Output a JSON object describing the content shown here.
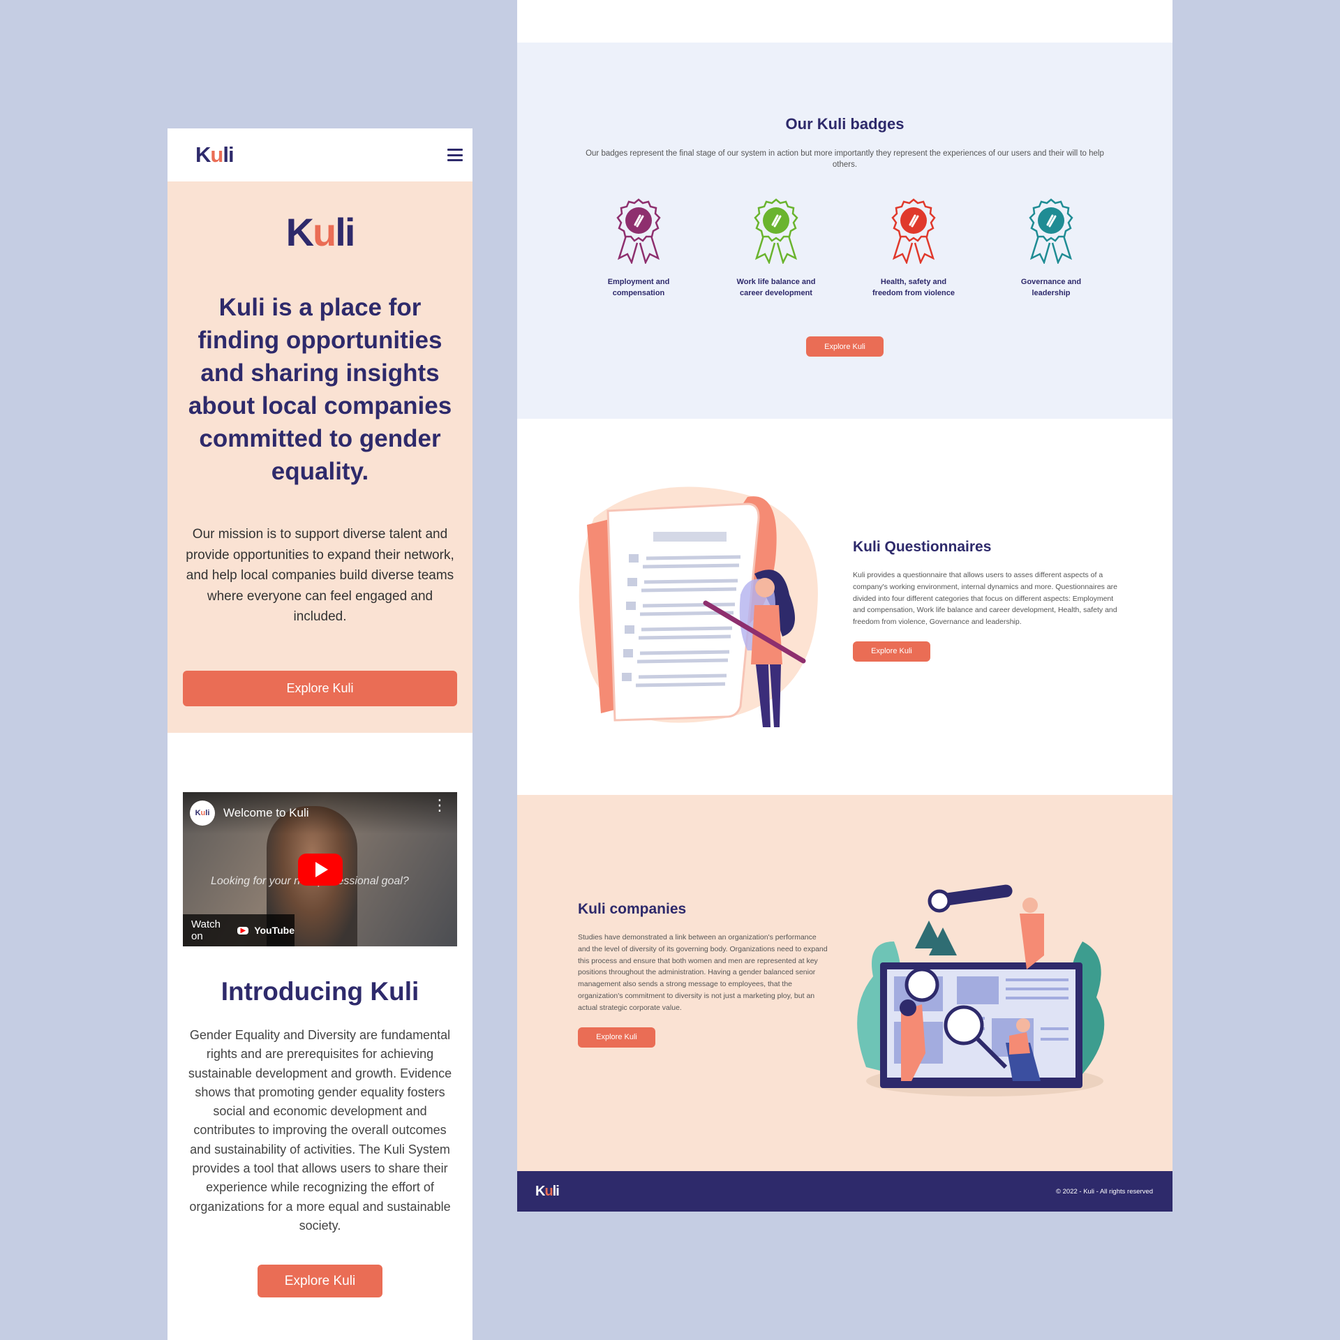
{
  "brand": {
    "logo_text": "Kuli"
  },
  "mobile": {
    "hero": {
      "headline": "Kuli is a place for finding opportunities and sharing insights about local companies committed to gender equality.",
      "mission": "Our mission is to support diverse talent and provide opportunities to expand their network, and help local companies build diverse teams where everyone can feel engaged and included.",
      "cta": "Explore Kuli"
    },
    "video": {
      "channel": "Kuli",
      "title": "Welcome to Kuli",
      "caption": "Looking for your next professional goal?",
      "watch_on": "Watch on",
      "youtube": "YouTube"
    },
    "intro": {
      "title": "Introducing Kuli",
      "body": "Gender Equality and Diversity are fundamental rights and are prerequisites for achieving sustainable development and growth. Evidence shows that promoting gender equality fosters social and economic development and contributes to improving the overall outcomes and sustainability of activities. The Kuli System provides a tool that allows users to share their experience while recognizing the effort of organizations for a more equal and sustainable society.",
      "cta": "Explore Kuli"
    }
  },
  "desktop": {
    "badges": {
      "title": "Our Kuli badges",
      "subtitle": "Our badges represent the final stage of our system in action but more importantly they represent the experiences of our users and their will to help others.",
      "items": [
        {
          "label": "Employment and compensation",
          "color": "#8e2f6e"
        },
        {
          "label": "Work life balance and career development",
          "color": "#6ab42e"
        },
        {
          "label": "Health, safety and freedom from violence",
          "color": "#e0392c"
        },
        {
          "label": "Governance and leadership",
          "color": "#1f8c94"
        }
      ],
      "cta": "Explore Kuli"
    },
    "questionnaires": {
      "title": "Kuli Questionnaires",
      "body": "Kuli provides a questionnaire that allows users to asses different aspects of a company's working environment, internal dynamics and more. Questionnaires are divided into four different categories that focus on different aspects: Employment and compensation, Work life balance and career development, Health, safety and freedom from violence, Governance and leadership.",
      "cta": "Explore Kuli"
    },
    "companies": {
      "title": "Kuli companies",
      "body": "Studies have demonstrated a link between an organization's performance and the level of diversity of its governing body. Organizations need to expand this process and ensure that both women and men are represented at key positions throughout the administration. Having a gender balanced senior management also sends a strong message to employees, that the organization's commitment to diversity is not just a marketing ploy, but an actual strategic corporate value.",
      "cta": "Explore Kuli"
    },
    "footer": {
      "copyright": "© 2022 - Kuli - All rights reserved"
    }
  },
  "colors": {
    "navy": "#2e2a6b",
    "coral": "#ea6d55",
    "peach": "#fae2d3",
    "lavender_bg": "#c5cde3",
    "badge_bg": "#edf1fa"
  }
}
